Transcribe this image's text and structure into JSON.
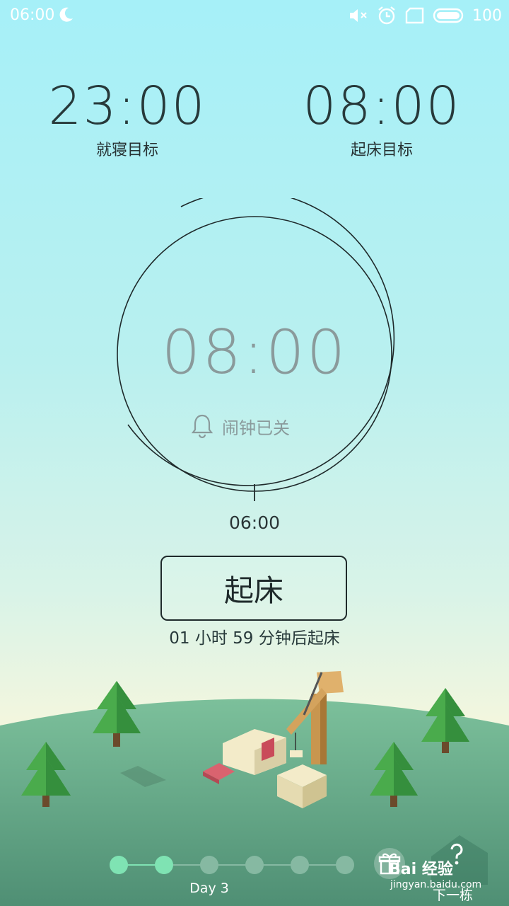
{
  "status_bar": {
    "time": "06:00",
    "battery": "100",
    "icons": [
      "moon-icon",
      "mute-icon",
      "alarm-icon",
      "screen-icon",
      "battery-icon"
    ]
  },
  "targets": {
    "bed": {
      "time": "23:00",
      "label": "就寝目标"
    },
    "wake": {
      "time": "08:00",
      "label": "起床目标"
    }
  },
  "dial": {
    "center_time": "08:00",
    "alarm_status": "闹钟已关",
    "tick_time": "06:00"
  },
  "wake_button": {
    "label": "起床"
  },
  "countdown": "01 小时 59 分钟后起床",
  "progress": {
    "day_label": "Day 3",
    "completed_steps": 2,
    "total_steps": 6,
    "next_label": "下一栋"
  },
  "watermark": {
    "main": "Bai 经验",
    "sub": "jingyan.baidu.com"
  },
  "colors": {
    "dot_active": "#7fe3b3",
    "dot_inactive": "#86b9a2",
    "hill": "#6fae8c",
    "tree": "#3c9a45"
  }
}
